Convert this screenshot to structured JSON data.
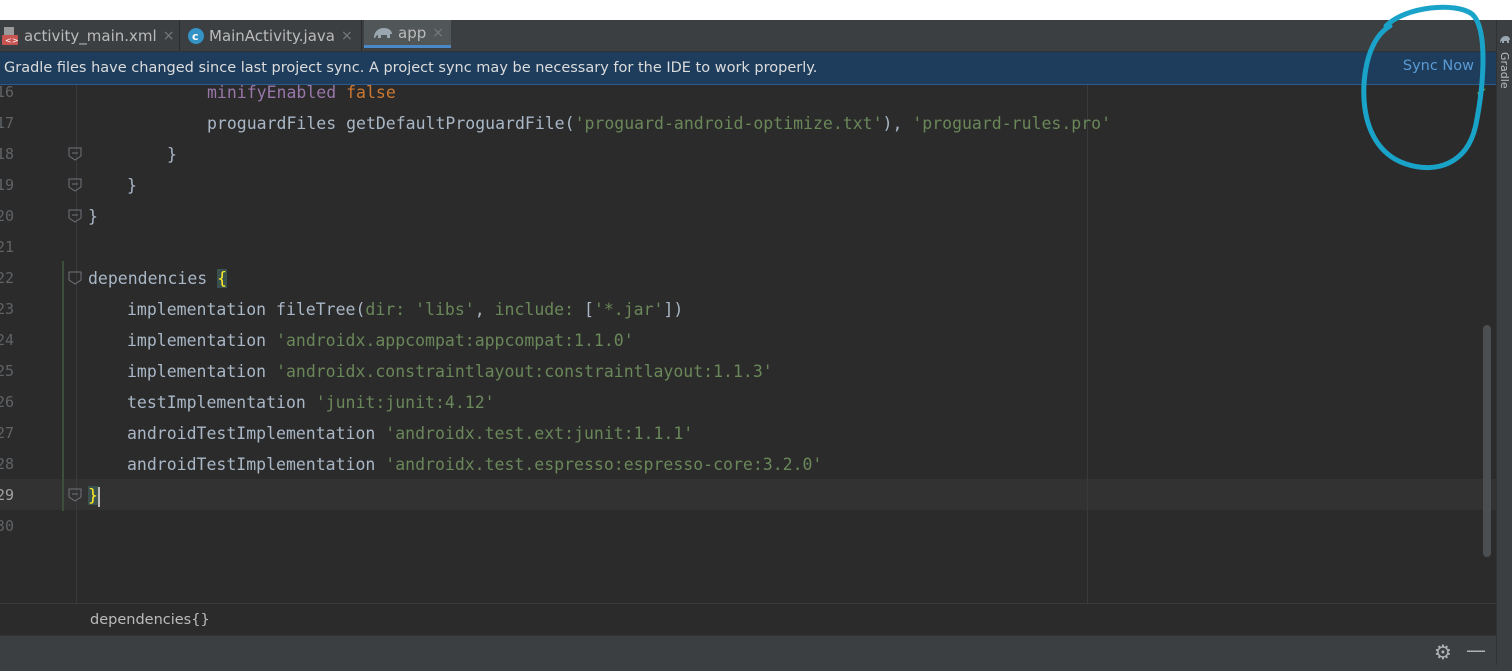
{
  "tabs": [
    {
      "label": "activity_main.xml",
      "icon": "xml-file-icon",
      "active": false
    },
    {
      "label": "MainActivity.java",
      "icon": "java-class-icon",
      "active": false
    },
    {
      "label": "app",
      "icon": "gradle-elephant-icon",
      "active": true
    }
  ],
  "tab_close_glyph": "×",
  "banner": {
    "message": "Gradle files have changed since last project sync. A project sync may be necessary for the IDE to work properly.",
    "action": "Sync Now"
  },
  "side_panel": {
    "label": "Gradle"
  },
  "code": {
    "line_numbers": [
      "16",
      "17",
      "18",
      "19",
      "20",
      "21",
      "22",
      "23",
      "24",
      "25",
      "26",
      "27",
      "28",
      "29",
      "30"
    ],
    "current_line": "29",
    "l16": {
      "kw": "minifyEnabled",
      "val": "false"
    },
    "l17": {
      "fn": "proguardFiles getDefaultProguardFile(",
      "s1": "'proguard-android-optimize.txt'",
      "mid": "), ",
      "s2": "'proguard-rules.pro'"
    },
    "l18": "}",
    "l19": "}",
    "l20": "}",
    "l22": {
      "text": "dependencies ",
      "brace": "{"
    },
    "l23": {
      "a": "implementation fileTree(",
      "p1": "dir: ",
      "s1": "'libs'",
      "c": ", ",
      "p2": "include: ",
      "b": "[",
      "s2": "'*.jar'",
      "e": "])"
    },
    "l24": {
      "a": "implementation ",
      "s": "'androidx.appcompat:appcompat:1.1.0'"
    },
    "l25": {
      "a": "implementation ",
      "s": "'androidx.constraintlayout:constraintlayout:1.1.3'"
    },
    "l26": {
      "a": "testImplementation ",
      "s": "'junit:junit:4.12'"
    },
    "l27": {
      "a": "androidTestImplementation ",
      "s": "'androidx.test.ext:junit:1.1.1'"
    },
    "l28": {
      "a": "androidTestImplementation ",
      "s": "'androidx.test.espresso:espresso-core:3.2.0'"
    },
    "l29": "}"
  },
  "breadcrumb": "dependencies{}",
  "toolbar": {
    "settings_icon": "gear-icon",
    "hide_icon": "minimize-icon"
  },
  "colors": {
    "keyword": "#9876aa",
    "string": "#6a8759",
    "text": "#a9b7c6",
    "annotation_circle": "#1aa3c9",
    "banner_bg": "#1e3d5c",
    "sync_link": "#5a9bd6"
  }
}
